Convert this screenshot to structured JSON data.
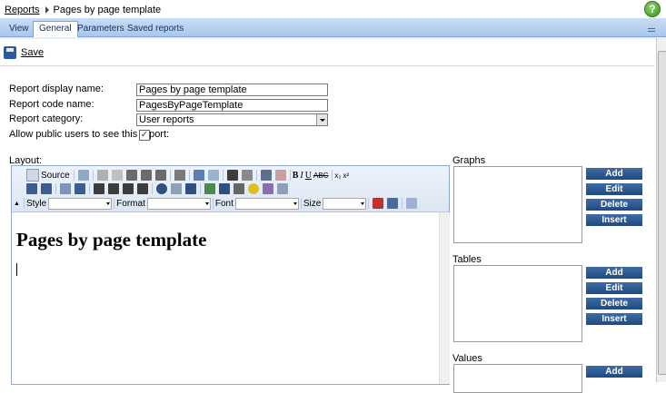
{
  "breadcrumb": {
    "parent": "Reports",
    "current": "Pages by page template"
  },
  "tabs": [
    "View",
    "General",
    "Parameters",
    "Saved reports"
  ],
  "active_tab": "General",
  "toolbar": {
    "save_label": "Save"
  },
  "form": {
    "display_name_label": "Report display name:",
    "display_name_value": "Pages by page template",
    "code_name_label": "Report code name:",
    "code_name_value": "PagesByPageTemplate",
    "category_label": "Report category:",
    "category_value": "User reports",
    "public_label": "Allow public users to see this report:",
    "public_checked": true,
    "layout_label": "Layout:"
  },
  "editor": {
    "source_label": "Source",
    "style_label": "Style",
    "format_label": "Format",
    "font_label": "Font",
    "size_label": "Size",
    "heading": "Pages by page template"
  },
  "sections": {
    "graphs_label": "Graphs",
    "tables_label": "Tables",
    "values_label": "Values",
    "add_label": "Add",
    "edit_label": "Edit",
    "delete_label": "Delete",
    "insert_label": "Insert"
  },
  "colors": {
    "accent": "#2a558f",
    "tab_bar": "#b8d0ee"
  }
}
